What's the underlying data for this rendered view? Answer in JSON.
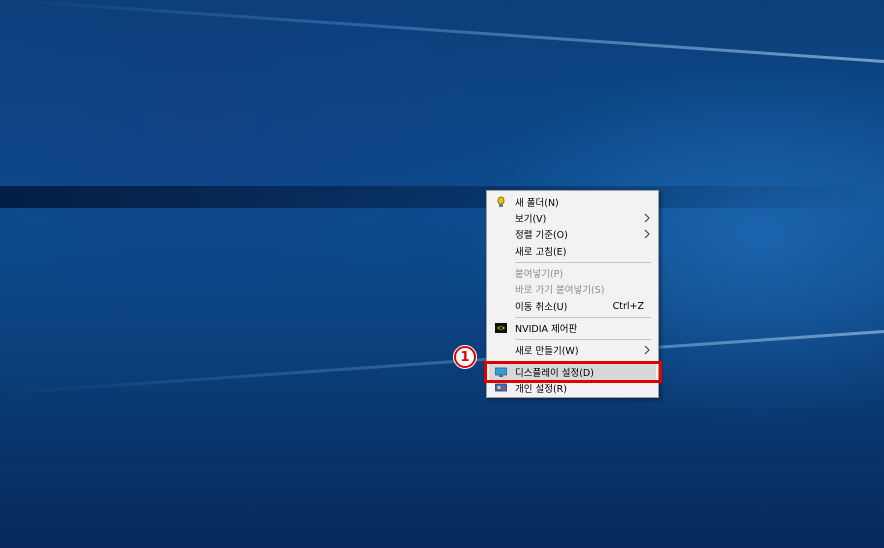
{
  "desktop": {
    "background_color": "#0b4a8c"
  },
  "context_menu": {
    "items": [
      {
        "label": "새 폴더(N)",
        "icon": "new-folder-icon"
      },
      {
        "label": "보기(V)",
        "submenu": true
      },
      {
        "label": "정렬 기준(O)",
        "submenu": true
      },
      {
        "label": "새로 고침(E)"
      },
      {
        "label": "붙여넣기(P)",
        "disabled": true
      },
      {
        "label": "바로 가기 붙여넣기(S)",
        "disabled": true
      },
      {
        "label": "이동 취소(U)",
        "shortcut": "Ctrl+Z"
      },
      {
        "label": "NVIDIA 제어판",
        "icon": "nvidia-icon"
      },
      {
        "label": "새로 만들기(W)",
        "submenu": true
      },
      {
        "label": "디스플레이 설정(D)",
        "icon": "display-icon",
        "highlighted": true
      },
      {
        "label": "개인 설정(R)",
        "icon": "personalize-icon"
      }
    ]
  },
  "annotation": {
    "step_number": "1",
    "color": "#e00000"
  }
}
